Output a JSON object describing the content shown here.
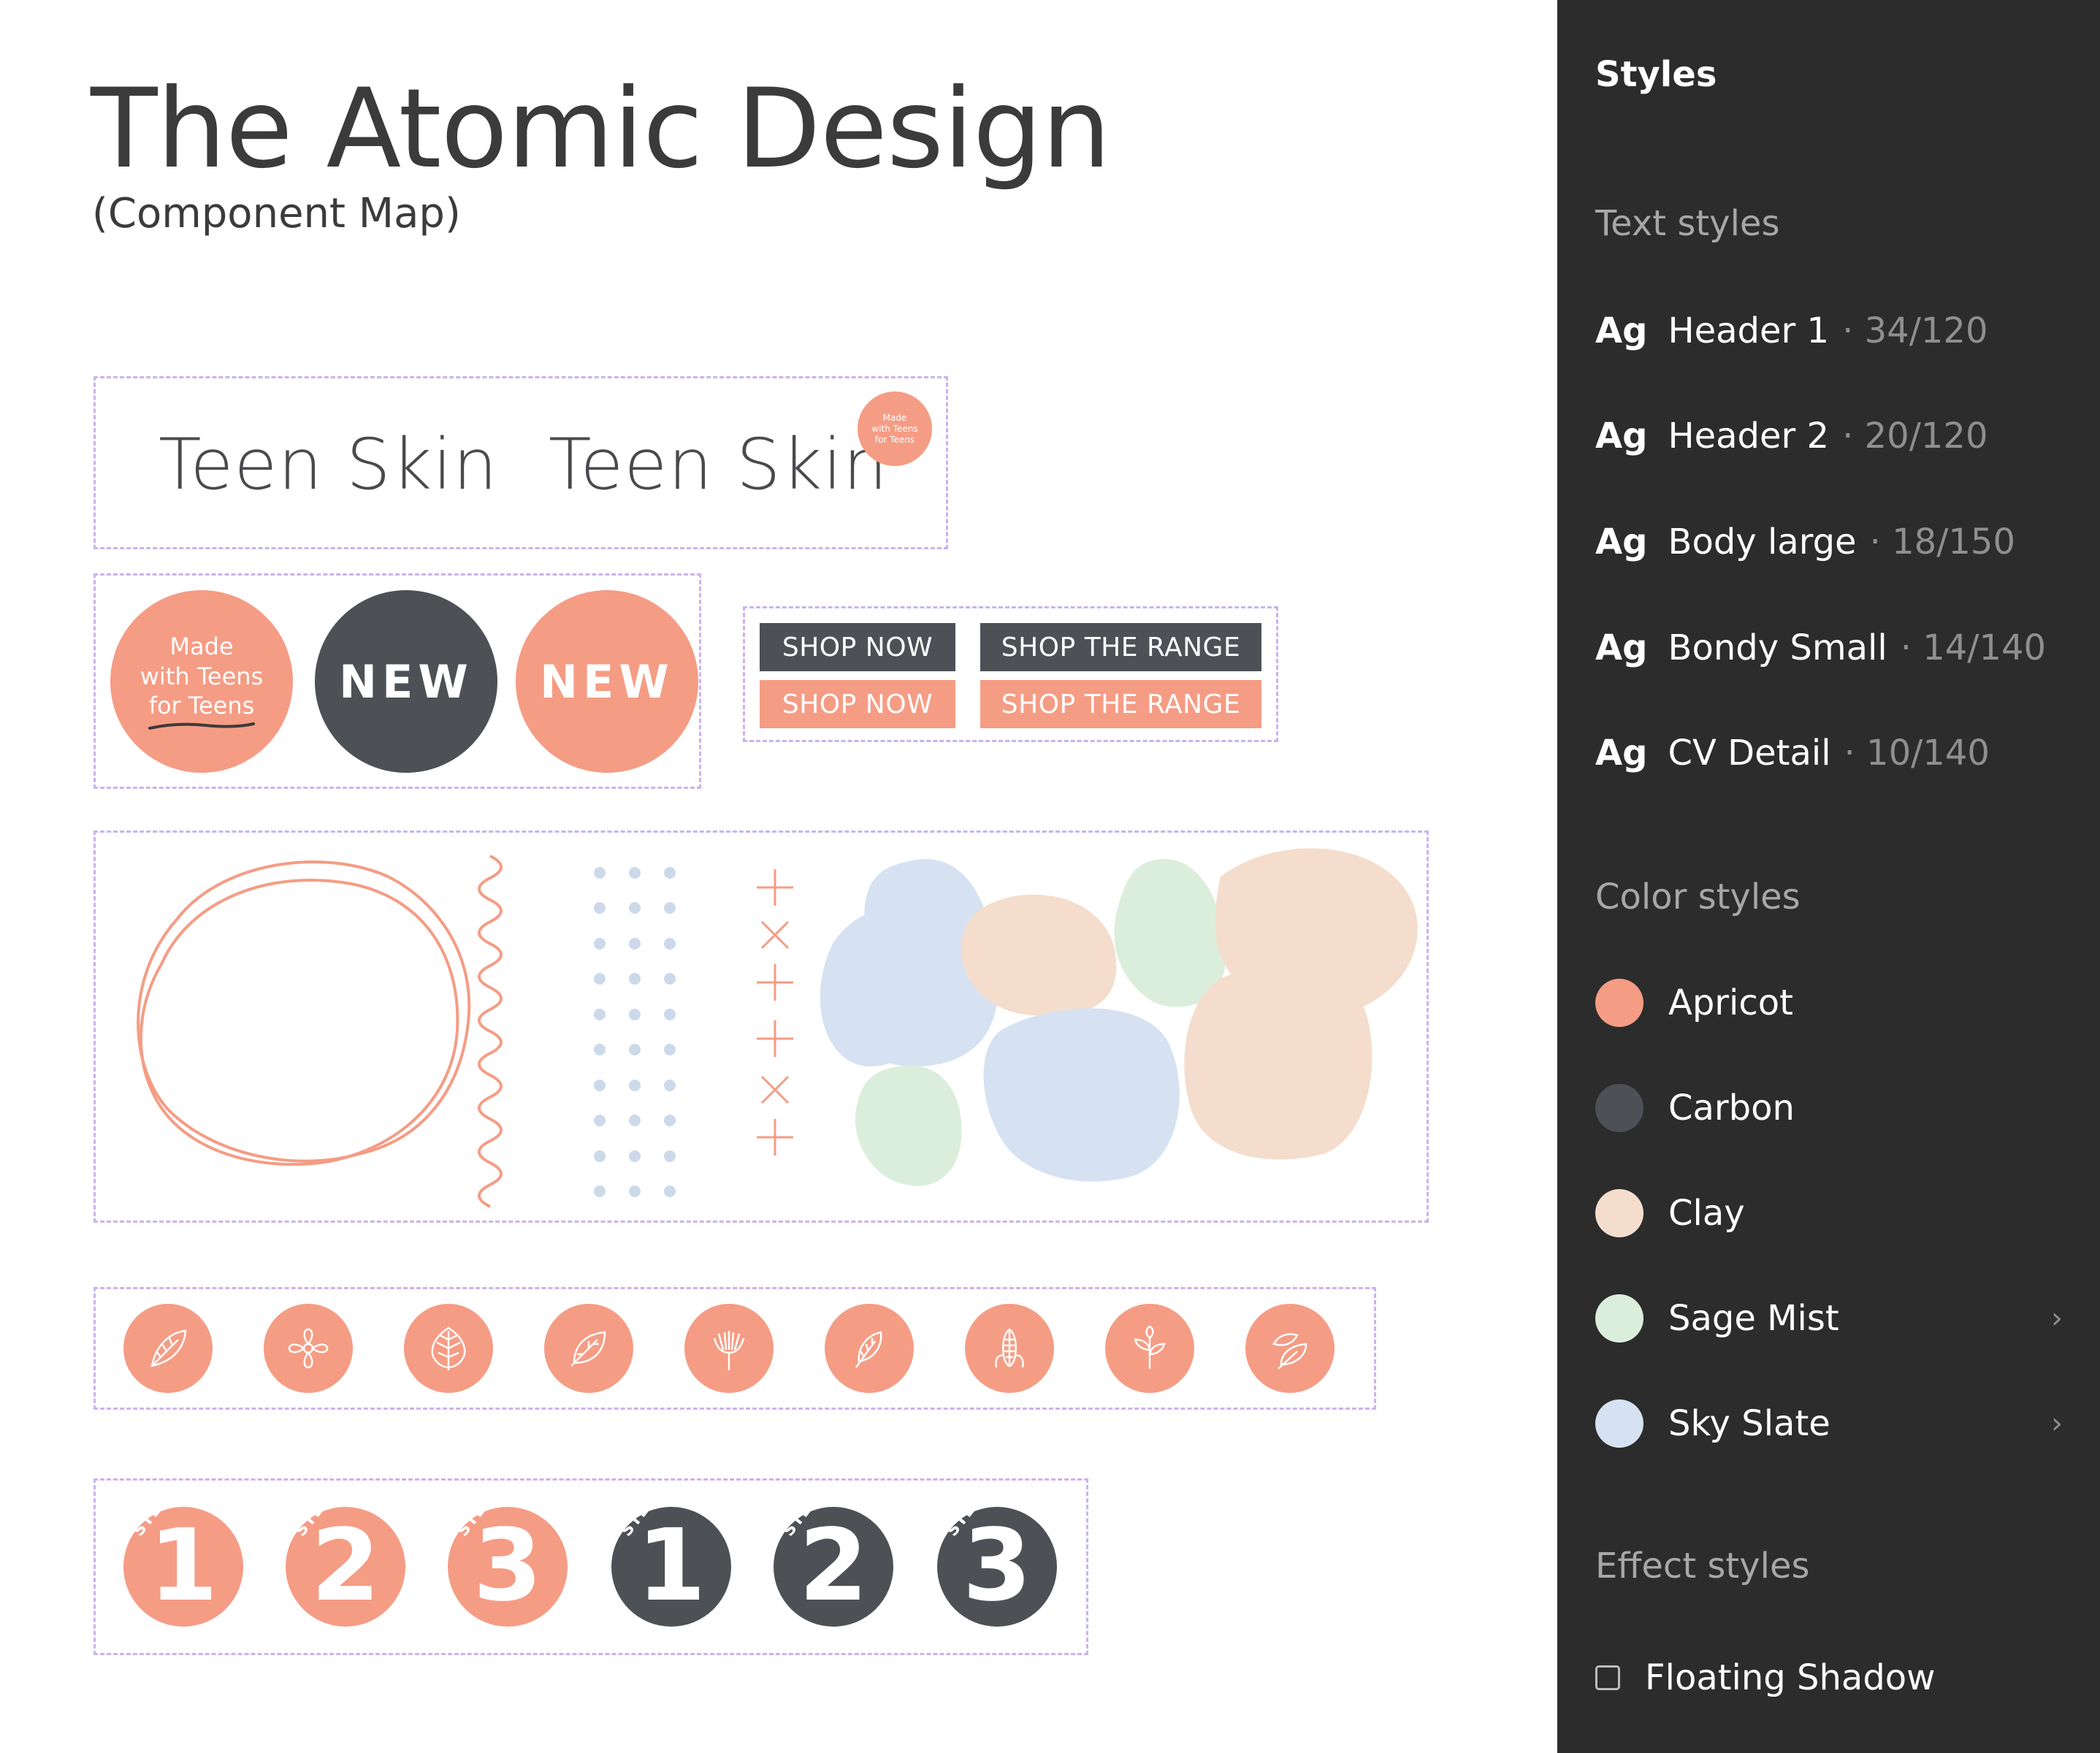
{
  "canvas": {
    "title": "The Atomic Design",
    "subtitle": "(Component Map)"
  },
  "logos": {
    "wordmark": "Teen Skin",
    "mini_badge_lines": [
      "Made",
      "with Teens",
      "for Teens"
    ]
  },
  "badges": {
    "made_lines": [
      "Made",
      "with Teens",
      "for Teens"
    ],
    "new_label": "NEW"
  },
  "buttons": {
    "shop_now": "SHOP NOW",
    "shop_range": "SHOP THE RANGE"
  },
  "icons": [
    "leaf-icon",
    "flower-icon",
    "maple-leaf-icon",
    "leaf-veined-icon",
    "dandelion-icon",
    "feather-icon",
    "corn-icon",
    "sprout-icon",
    "leaves-icon"
  ],
  "steps": {
    "word": "STEP",
    "numbers": [
      "1",
      "2",
      "3",
      "1",
      "2",
      "3"
    ]
  },
  "sidebar": {
    "title": "Styles",
    "text_styles_heading": "Text styles",
    "text_styles": [
      {
        "ag": "Ag",
        "name": "Header 1",
        "spec": "· 34/120"
      },
      {
        "ag": "Ag",
        "name": "Header 2",
        "spec": "· 20/120"
      },
      {
        "ag": "Ag",
        "name": "Body large",
        "spec": "· 18/150"
      },
      {
        "ag": "Ag",
        "name": "Bondy Small",
        "spec": "· 14/140"
      },
      {
        "ag": "Ag",
        "name": "CV Detail",
        "spec": "· 10/140"
      }
    ],
    "color_styles_heading": "Color styles",
    "color_styles": [
      {
        "name": "Apricot",
        "hex": "#f59c84",
        "chevron": ""
      },
      {
        "name": "Carbon",
        "hex": "#4d5155",
        "chevron": ""
      },
      {
        "name": "Clay",
        "hex": "#f4ddcc",
        "chevron": ""
      },
      {
        "name": "Sage Mist",
        "hex": "#dbeedb",
        "chevron": "›"
      },
      {
        "name": "Sky Slate",
        "hex": "#d6e2f1",
        "chevron": "›"
      }
    ],
    "effect_styles_heading": "Effect styles",
    "effect_styles": [
      {
        "name": "Floating Shadow"
      }
    ]
  },
  "colors": {
    "apricot": "#f59c84",
    "carbon": "#4d5155",
    "clay": "#f4ddcc",
    "sage_mist": "#dbeedb",
    "sky_slate": "#d6e2f1",
    "frame_border": "#c9b3ef",
    "sidebar_bg": "#2c2c2c"
  }
}
